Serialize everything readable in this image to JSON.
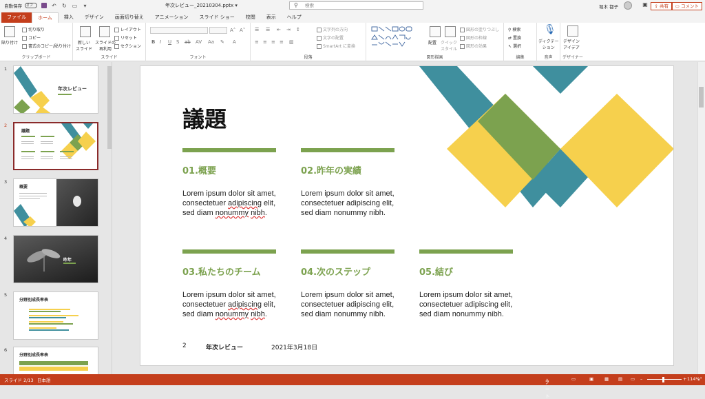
{
  "titlebar": {
    "autosave": "自動保存",
    "autosave_state": "オフ",
    "filename": "年次レビュー_20210304.pptx ▾",
    "search_placeholder": "検索",
    "username": "堀木 都子"
  },
  "tabs": [
    "ファイル",
    "ホーム",
    "挿入",
    "デザイン",
    "画面切り替え",
    "アニメーション",
    "スライド ショー",
    "校閲",
    "表示",
    "ヘルプ"
  ],
  "share_label": "共有",
  "comment_label": "コメント",
  "ribbon": {
    "clipboard": {
      "paste": "貼り付け",
      "cut": "切り取り",
      "copy": "コピー",
      "format_painter": "書式のコピー/貼り付け",
      "label": "クリップボード"
    },
    "slides": {
      "new_slide": "新しい\nスライド",
      "reuse": "スライドの\n再利用",
      "layout": "レイアウト",
      "reset": "リセット",
      "section": "セクション",
      "label": "スライド"
    },
    "font": {
      "label": "フォント"
    },
    "paragraph": {
      "text_direction": "文字列の方向",
      "align_text": "文字の配置",
      "smartart": "SmartArt に変換",
      "label": "段落"
    },
    "drawing": {
      "arrange": "配置",
      "quick_styles": "クイック\nスタイル",
      "fill": "図形の塗りつぶし",
      "outline": "図形の枠線",
      "effects": "図形の効果",
      "label": "図形描画"
    },
    "editing": {
      "find": "検索",
      "replace": "置換",
      "select": "選択",
      "label": "編集"
    },
    "voice": {
      "dictate": "ディクテー\nション",
      "label": "音声"
    },
    "designer": {
      "ideas": "デザイン\nアイデア",
      "label": "デザイナー"
    }
  },
  "thumbnails": [
    {
      "num": "1",
      "title": "年次レビュー"
    },
    {
      "num": "2",
      "title": "議題"
    },
    {
      "num": "3",
      "title": "概要"
    },
    {
      "num": "4",
      "title": "昨年"
    },
    {
      "num": "5",
      "title": "分野別成長率表"
    },
    {
      "num": "6",
      "title": "分野別成長率表"
    }
  ],
  "slide": {
    "title": "議題",
    "sections": [
      {
        "title": "01.概要",
        "body": "Lorem ipsum dolor sit amet, consectetuer adipiscing elit, sed diam nonummy nibh."
      },
      {
        "title": "02.昨年の実績",
        "body": "Lorem ipsum dolor sit amet, consectetuer adipiscing elit, sed diam nonummy nibh."
      },
      {
        "title": "03.私たちのチーム",
        "body": "Lorem ipsum dolor sit amet, consectetuer adipiscing elit, sed diam nonummy nibh."
      },
      {
        "title": "04.次のステップ",
        "body": "Lorem ipsum dolor sit amet, consectetuer adipiscing elit, sed diam nonummy nibh."
      },
      {
        "title": "05.結び",
        "body": "Lorem ipsum dolor sit amet, consectetuer adipiscing elit, sed diam nonummy nibh."
      }
    ],
    "footer_page": "2",
    "footer_title": "年次レビュー",
    "footer_date": "2021年3月18日",
    "colors": {
      "teal": "#3f8f9e",
      "green": "#7ca24f",
      "yellow": "#f6d04d"
    }
  },
  "status": {
    "slide_info": "スライド 2/13",
    "language": "日本語",
    "notes": "ノート",
    "zoom": "114%"
  }
}
